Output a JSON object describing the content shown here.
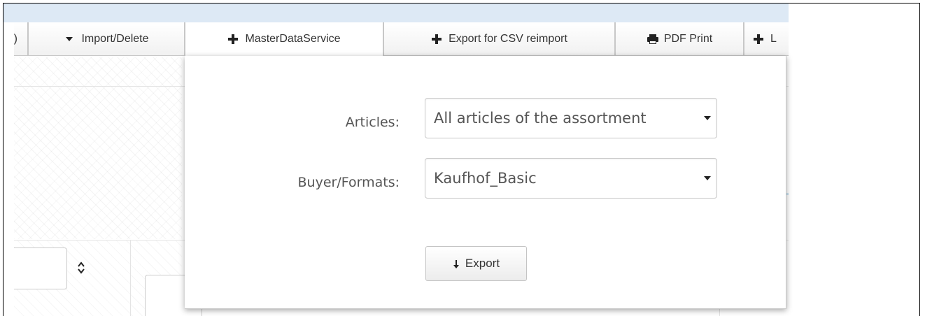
{
  "toolbar": {
    "items": [
      {
        "label": ")",
        "icon": "partial-edge"
      },
      {
        "label": "Import/Delete",
        "icon": "caret-down-icon"
      },
      {
        "label": "MasterDataService",
        "icon": "plus-icon"
      },
      {
        "label": "Export for CSV reimport",
        "icon": "plus-icon"
      },
      {
        "label": "PDF Print",
        "icon": "printer-icon"
      },
      {
        "label": "L",
        "icon": "plus-icon"
      }
    ]
  },
  "export_popover": {
    "articles_label": "Articles:",
    "articles_value": "All articles of the assortment",
    "buyer_label": "Buyer/Formats:",
    "buyer_value": "Kaufhof_Basic",
    "export_label": "Export",
    "export_icon": "download-arrow-icon"
  },
  "background": {
    "sort_icon": "sort-updown-icon"
  },
  "colors": {
    "top_strip": "#dde9f5",
    "button_border": "#c7c7c7",
    "text": "#333333",
    "link": "#2a8cc7"
  }
}
